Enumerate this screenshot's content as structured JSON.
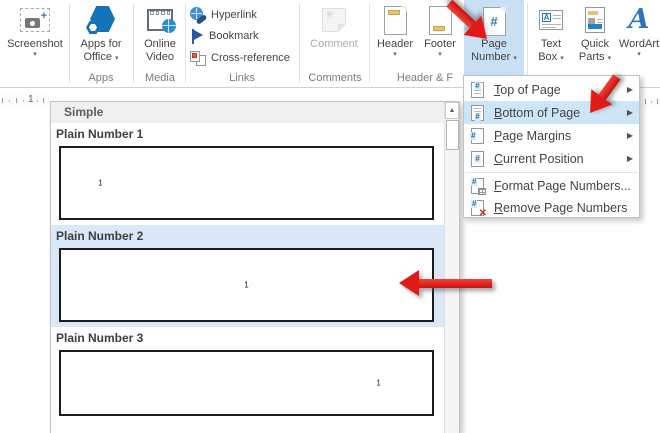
{
  "ribbon": {
    "caret": "▾",
    "screenshot": {
      "label": "Screenshot"
    },
    "apps_for_office": {
      "line1": "Apps for",
      "line2": "Office"
    },
    "online_video": {
      "line1": "Online",
      "line2": "Video"
    },
    "hyperlink": {
      "label": "Hyperlink"
    },
    "bookmark": {
      "label": "Bookmark"
    },
    "cross_reference": {
      "label": "Cross-reference"
    },
    "comment": {
      "label": "Comment"
    },
    "header": {
      "label": "Header"
    },
    "footer": {
      "label": "Footer"
    },
    "page_number": {
      "line1": "Page",
      "line2": "Number"
    },
    "text_box": {
      "line1": "Text",
      "line2": "Box"
    },
    "quick_parts": {
      "line1": "Quick",
      "line2": "Parts"
    },
    "wordart": {
      "label": "WordArt"
    },
    "group_labels": {
      "apps": "Apps",
      "media": "Media",
      "links": "Links",
      "comments": "Comments",
      "header_footer": "Header & F"
    }
  },
  "menu": {
    "submenu_arrow": "▶",
    "items": [
      {
        "first": "T",
        "rest": "op of Page",
        "submenu": true,
        "highlighted": false
      },
      {
        "first": "B",
        "rest": "ottom of Page",
        "submenu": true,
        "highlighted": true
      },
      {
        "first": "P",
        "rest": "age Margins",
        "submenu": true,
        "highlighted": false
      },
      {
        "first": "C",
        "rest": "urrent Position",
        "submenu": true,
        "highlighted": false
      },
      {
        "first": "F",
        "rest": "ormat Page Numbers...",
        "submenu": false,
        "highlighted": false
      },
      {
        "first": "R",
        "rest": "emove Page Numbers",
        "submenu": false,
        "highlighted": false
      }
    ]
  },
  "gallery": {
    "section_title": "Simple",
    "items": [
      {
        "title": "Plain Number 1",
        "page_number": "1",
        "align": "left",
        "selected": false
      },
      {
        "title": "Plain Number 2",
        "page_number": "1",
        "align": "center",
        "selected": true
      },
      {
        "title": "Plain Number 3",
        "page_number": "1",
        "align": "right",
        "selected": false
      }
    ],
    "scrollbar_up": "▲"
  },
  "ruler": {
    "number": "1"
  },
  "icons": {
    "hash": "#",
    "plus": "+",
    "letter_a": "A",
    "comment_star": "✳",
    "remove_x": "✕"
  },
  "colors": {
    "ribbon_button_highlight": "#c8dff4",
    "menu_row_highlight": "#cde6f7",
    "gallery_selection": "#d9e7f7",
    "arrow_red": "#e11a17",
    "accent_blue": "#2e75b5",
    "tan_bar": "#e9c46f"
  }
}
